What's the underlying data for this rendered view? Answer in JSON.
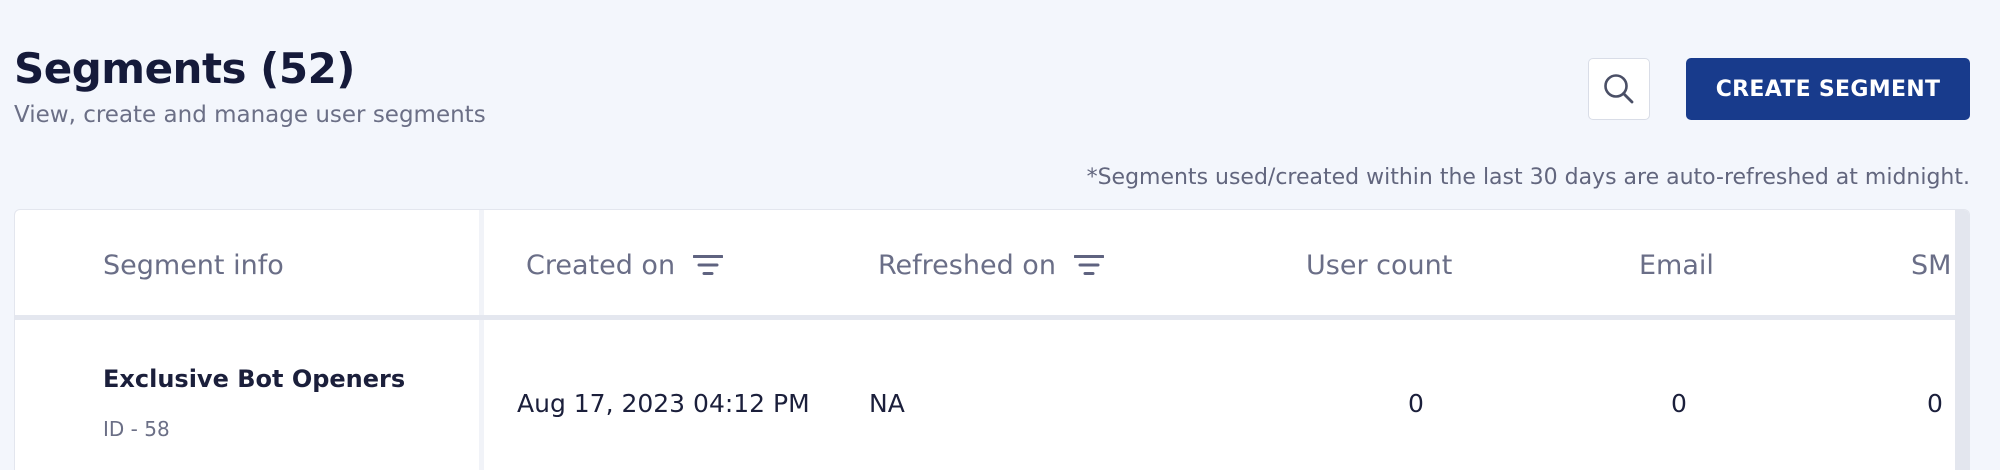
{
  "header": {
    "title": "Segments (52)",
    "subtitle": "View, create and manage user segments",
    "search_icon": "search-icon",
    "create_label": "CREATE SEGMENT",
    "note": "*Segments used/created within the last 30 days are auto-refreshed at midnight."
  },
  "colors": {
    "primary": "#183b8c",
    "background": "#f3f6fc",
    "title": "#151a3a",
    "muted": "#6b6f86"
  },
  "table": {
    "columns": {
      "info": "Segment info",
      "created": "Created on",
      "refreshed": "Refreshed on",
      "users": "User count",
      "email": "Email",
      "sms": "SM"
    },
    "filter_icon": "filter-icon",
    "rows": [
      {
        "name": "Exclusive Bot Openers",
        "id": "ID - 58",
        "created": "Aug 17, 2023 04:12 PM",
        "refreshed": "NA",
        "users": "0",
        "email": "0",
        "sms": "0"
      }
    ]
  }
}
